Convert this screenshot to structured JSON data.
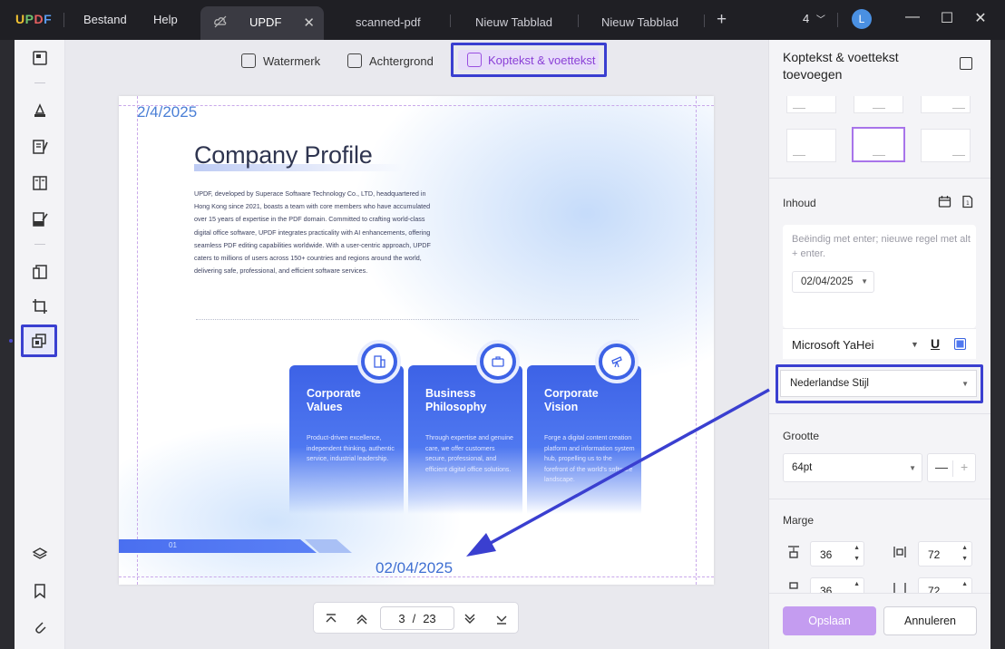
{
  "app": {
    "logo": "UPDF"
  },
  "menu": {
    "file": "Bestand",
    "help": "Help"
  },
  "tabs": [
    {
      "label": "UPDF",
      "active": true
    },
    {
      "label": "scanned-pdf"
    },
    {
      "label": "Nieuw Tabblad"
    },
    {
      "label": "Nieuw Tabblad"
    }
  ],
  "window": {
    "tab_count": "4",
    "avatar_initial": "L"
  },
  "modes": {
    "watermark": "Watermerk",
    "background": "Achtergrond",
    "header_footer": "Koptekst & voettekst"
  },
  "document": {
    "header_date": "2/4/2025",
    "footer_date": "02/04/2025",
    "title": "Company Profile",
    "description": "UPDF, developed by Superace Software Technology Co., LTD, headquartered in Hong Kong since 2021, boasts a team with core members who have accumulated over 15 years of expertise in the PDF domain. Committed to crafting world-class digital office software, UPDF integrates practicality with AI enhancements, offering seamless PDF editing capabilities worldwide. With a user-centric approach, UPDF caters to millions of users across 150+ countries and regions around the world, delivering safe, professional, and efficient software services.",
    "page_marker": "01",
    "cards": [
      {
        "title": "Corporate Values",
        "text": "Product-driven excellence, independent thinking, authentic service, industrial leadership."
      },
      {
        "title": "Business Philosophy",
        "text": "Through expertise and genuine care, we offer customers secure, professional, and efficient digital office solutions."
      },
      {
        "title": "Corporate Vision",
        "text": "Forge a digital content creation platform and information system hub, propelling us to the forefront of the world's software landscape."
      }
    ]
  },
  "pagination": {
    "current": "3",
    "separator": "/",
    "total": "23"
  },
  "panel": {
    "title": "Koptekst & voettekst toevoegen",
    "content_label": "Inhoud",
    "content_placeholder": "Beëindig met enter; nieuwe regel met alt + enter.",
    "date_format": "02/04/2025",
    "font": "Microsoft YaHei",
    "underline_label": "U",
    "style": "Nederlandse Stijl",
    "size_label": "Grootte",
    "size_value": "64pt",
    "size_minus": "—",
    "size_plus": "+",
    "margin_label": "Marge",
    "margins": {
      "top": "36",
      "left_right": "72",
      "bottom": "36",
      "side2": "72"
    },
    "save": "Opslaan",
    "cancel": "Annuleren"
  },
  "colors": {
    "accent": "#3a3fd0",
    "brand_purple": "#a874ea",
    "card_blue": "#3d62e6"
  }
}
